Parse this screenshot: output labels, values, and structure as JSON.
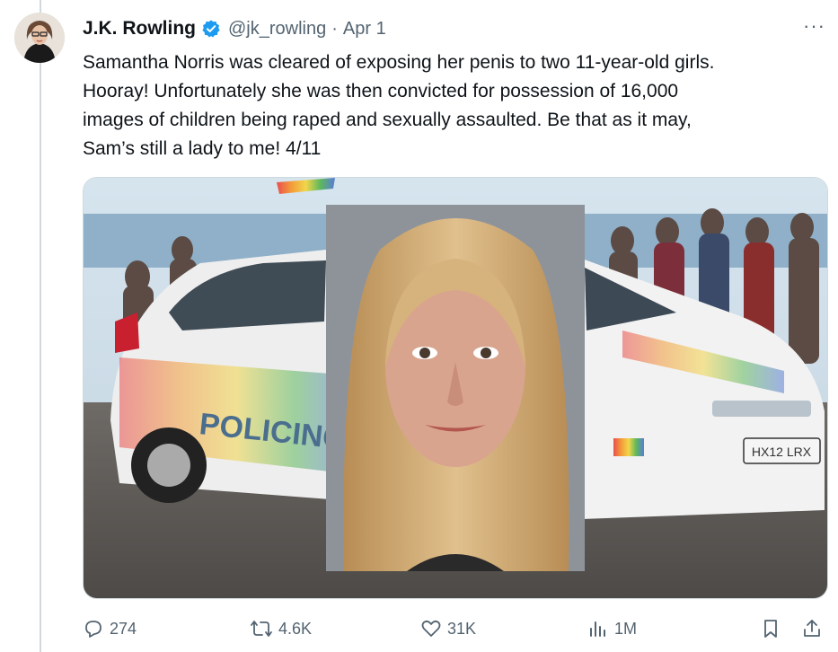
{
  "tweet": {
    "author_name": "J.K. Rowling",
    "handle": "@jk_rowling",
    "separator": "·",
    "date": "Apr 1",
    "more_label": "···",
    "text_lines": [
      "Samantha Norris was cleared of exposing her penis to two 11-year-old girls.",
      "Hooray! Unfortunately she was then convicted for possession of 16,000",
      "images of children being raped and sexually assaulted. Be that as it may,",
      "Sam’s still a lady to me! 4/11"
    ]
  },
  "media": {
    "car_text": "POLICING PR",
    "plate": "HX12 LRX"
  },
  "actions": {
    "replies": "274",
    "reposts": "4.6K",
    "likes": "31K",
    "views": "1M"
  },
  "colors": {
    "verified_blue": "#1d9bf0",
    "muted": "#536471",
    "divider": "#cfd9de"
  },
  "icons": [
    "verified-badge-icon",
    "more-icon",
    "reply-icon",
    "repost-icon",
    "like-icon",
    "views-icon",
    "bookmark-icon",
    "share-icon"
  ]
}
